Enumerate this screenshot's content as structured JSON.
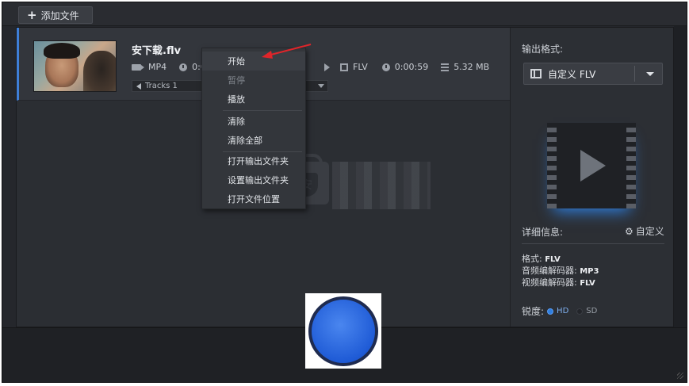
{
  "toolbar": {
    "add_file_label": "添加文件"
  },
  "file": {
    "name": "安下载.flv",
    "source": {
      "format": "MP4",
      "duration": "0:00:"
    },
    "output": {
      "format": "FLV",
      "duration": "0:00:59",
      "size": "5.32 MB"
    },
    "track": "Tracks 1"
  },
  "context_menu": {
    "items": [
      {
        "label": "开始",
        "highlighted": true,
        "disabled": false
      },
      {
        "label": "暂停",
        "highlighted": false,
        "disabled": true
      },
      {
        "label": "播放",
        "highlighted": false,
        "disabled": false
      },
      {
        "label": "清除",
        "highlighted": false,
        "disabled": false
      },
      {
        "label": "清除全部",
        "highlighted": false,
        "disabled": false
      },
      {
        "label": "打开输出文件夹",
        "highlighted": false,
        "disabled": false
      },
      {
        "label": "设置输出文件夹",
        "highlighted": false,
        "disabled": false
      },
      {
        "label": "打开文件位置",
        "highlighted": false,
        "disabled": false
      }
    ]
  },
  "side": {
    "output_format_label": "输出格式:",
    "selected_format": "自定义 FLV",
    "details_label": "详细信息:",
    "custom_label": "自定义",
    "format_line": {
      "label": "格式:",
      "value": "FLV"
    },
    "audio_codec_line": {
      "label": "音频编解码器:",
      "value": "MP3"
    },
    "video_codec_line": {
      "label": "视频编解码器:",
      "value": "FLV"
    },
    "sharpness_label": "锐度:",
    "hd_label": "HD",
    "sd_label": "SD",
    "selected_sharpness": "HD"
  },
  "watermark_glyph": "安",
  "colors": {
    "accent": "#2f7fe0",
    "annotation_arrow": "#e0252a",
    "convert_button": "#1f5bd6"
  }
}
